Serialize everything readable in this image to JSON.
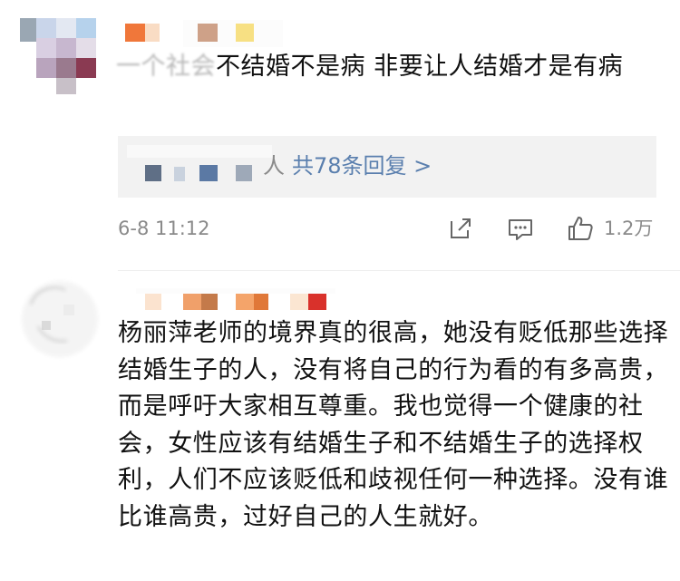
{
  "comment1": {
    "text_obscured_prefix": "一个社会",
    "text": "不结婚不是病 非要让人结婚才是有病",
    "replies": {
      "obscured_prefix": "人",
      "link_label": "共78条回复 >"
    },
    "time": "6-8 11:12",
    "like_count": "1.2万"
  },
  "comment2": {
    "text": "杨丽萍老师的境界真的很高，她没有贬低那些选择结婚生子的人，没有将自己的行为看的有多高贵，而是呼吁大家相互尊重。我也觉得一个健康的社会，女性应该有结婚生子和不结婚生子的选择权利，人们不应该贬低和歧视任何一种选择。没有谁比谁高贵，过好自己的人生就好。"
  },
  "icons": {
    "share": "share-icon",
    "comment": "comment-icon",
    "like": "thumbs-up-icon"
  },
  "colors": {
    "link": "#5a7fae",
    "meta": "#8a8a8a",
    "reply_bg": "#f2f2f2",
    "text": "#111111"
  }
}
